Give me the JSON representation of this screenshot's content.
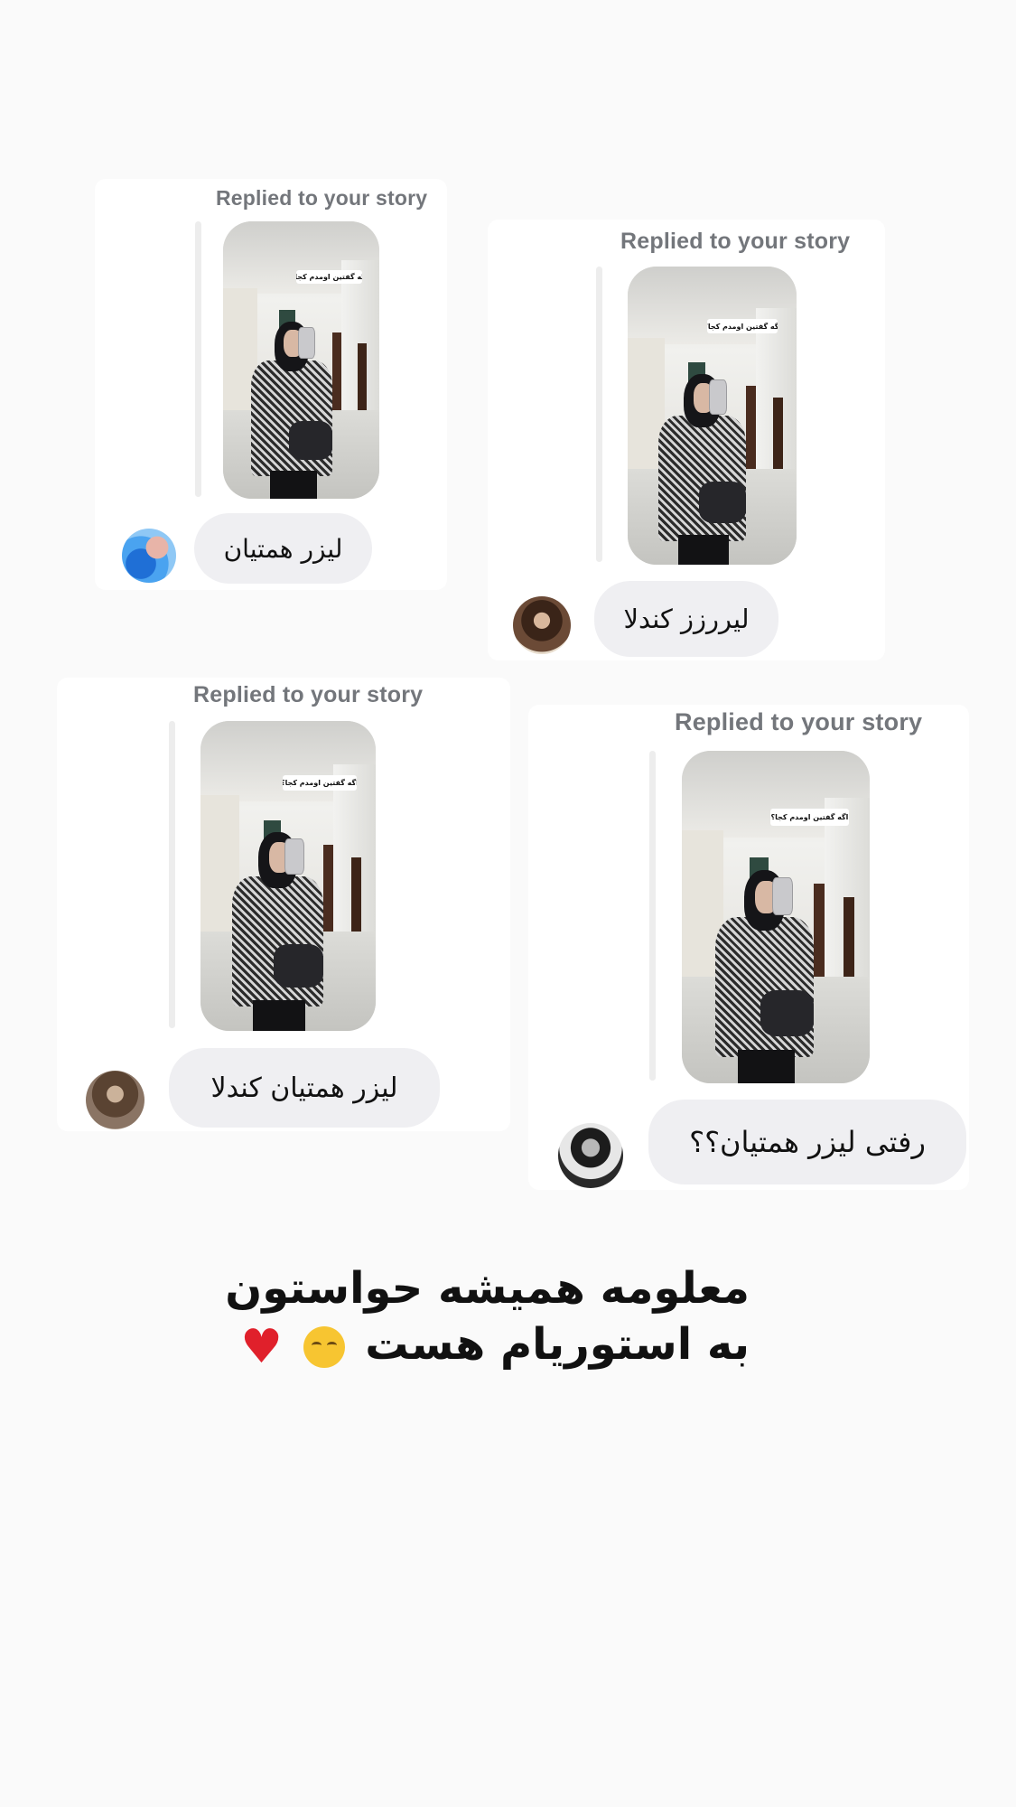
{
  "replied_label": "Replied to your story",
  "story_sticker_text": "اگه گفتین اومدم کجا؟",
  "replies": [
    {
      "message": "لیزر همتیان",
      "avatar": "user-avatar-blue-flowers"
    },
    {
      "message": "لیررزز کندلا",
      "avatar": "user-avatar-selfie"
    },
    {
      "message": "لیزر همتیان کندلا",
      "avatar": "user-avatar-long-hair"
    },
    {
      "message": "رفتی لیزر همتیان؟؟",
      "avatar": "user-avatar-bw-portrait"
    }
  ],
  "caption": {
    "line1": "معلومه همیشه حواستون",
    "line2": "به استوریام هست",
    "emojis": [
      "relieved-face-emoji",
      "red-heart-emoji"
    ]
  },
  "colors": {
    "background": "#fafafa",
    "card": "#ffffff",
    "bubble": "#efeff2",
    "replied_text": "#73767b"
  }
}
